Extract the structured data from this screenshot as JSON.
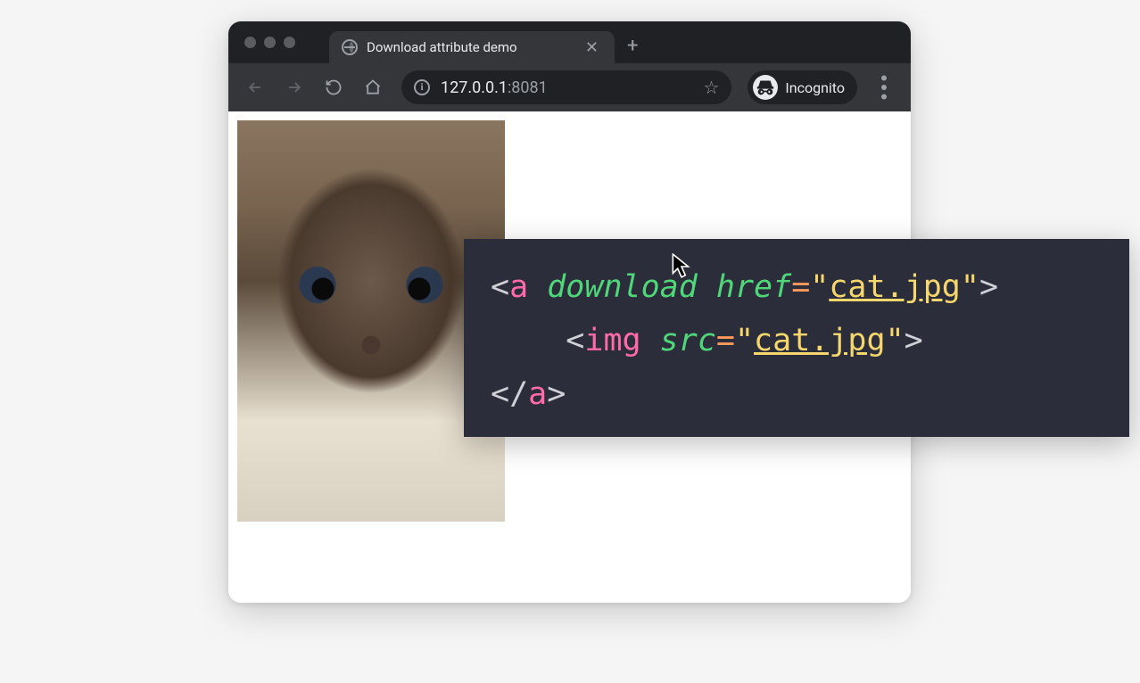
{
  "browser": {
    "tab_title": "Download attribute demo",
    "url_host": "127.0.0.1",
    "url_port": ":8081",
    "incognito_label": "Incognito"
  },
  "code": {
    "line1": {
      "open": "<",
      "tag": "a",
      "sp1": " ",
      "attr1": "download",
      "sp2": " ",
      "attr2": "href",
      "eq": "=",
      "q1": "\"",
      "val": "cat.jpg",
      "q2": "\"",
      "close": ">"
    },
    "line2": {
      "indent": "    ",
      "open": "<",
      "tag": "img",
      "sp": " ",
      "attr": "src",
      "eq": "=",
      "q1": "\"",
      "val": "cat.jpg",
      "q2": "\"",
      "close": ">"
    },
    "line3": {
      "open": "</",
      "tag": "a",
      "close": ">"
    }
  }
}
